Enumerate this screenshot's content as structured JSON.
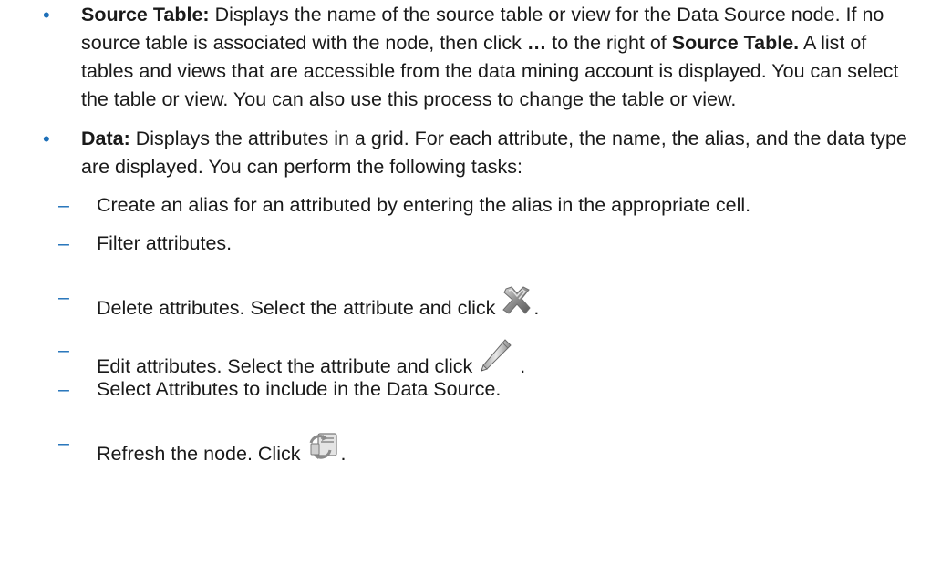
{
  "items": [
    {
      "bullet": "•",
      "term": "Source Table:",
      "text_1": " Displays the name of the source table or view for the Data Source node. If no source table is associated with the node, then click ",
      "ellipsis": "…",
      "text_2": " to the right of ",
      "term_2": "Source Table.",
      "text_3": " A list of tables and views that are accessible from the data mining account is displayed. You can select the table or view. You can also use this process to change the table or view."
    },
    {
      "bullet": "•",
      "term": "Data:",
      "text_1": " Displays the attributes in a grid. For each attribute, the name, the alias, and the data type are displayed. You can perform the following tasks:"
    }
  ],
  "sub_items": [
    {
      "dash": "–",
      "text": "Create an alias for an attributed by entering the alias in the appropriate cell."
    },
    {
      "dash": "–",
      "text": "Filter attributes."
    },
    {
      "dash": "–",
      "text": "Delete attributes. Select the attribute and click ",
      "after": ".",
      "icon": "delete-x-icon"
    },
    {
      "dash": "–",
      "text": "Edit attributes. Select the attribute and click ",
      "after": ".",
      "icon": "pencil-edit-icon"
    },
    {
      "dash": "–",
      "text": "Select Attributes to include in the Data Source."
    },
    {
      "dash": "–",
      "text": "Refresh the node. Click ",
      "after": ".",
      "icon": "refresh-icon"
    }
  ]
}
